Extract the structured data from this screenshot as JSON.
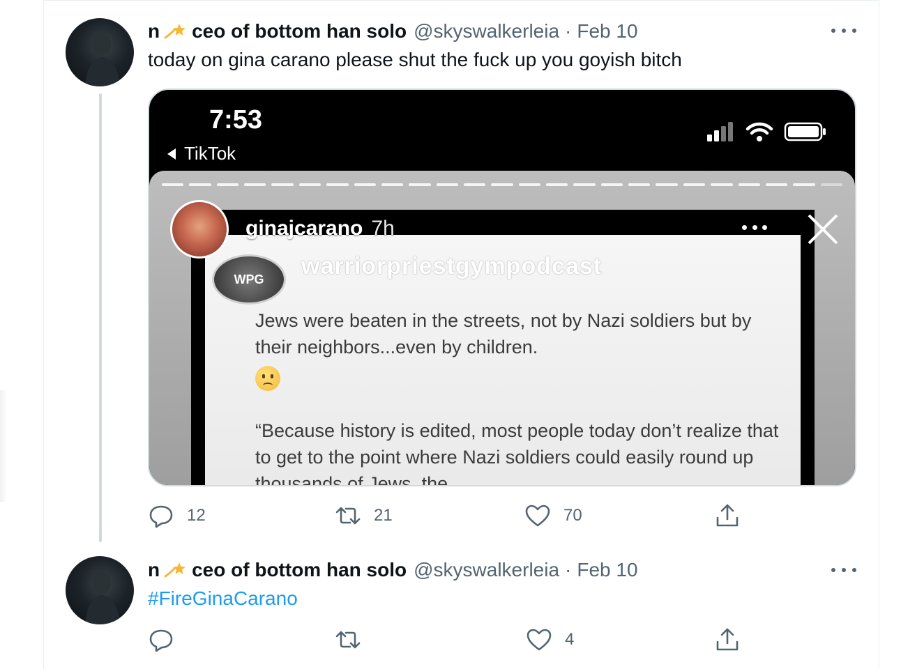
{
  "tweets": [
    {
      "display_name_short": "n",
      "display_name_rest": "ceo of bottom han solo",
      "handle": "@skyswalkerleia",
      "separator": "·",
      "date": "Feb 10",
      "text": "today on gina carano please shut the fuck up you goyish bitch",
      "media": {
        "phone_time": "7:53",
        "back_app": "TikTok",
        "story_username": "ginajcarano",
        "story_time": "7h",
        "logo_text": "WPG",
        "watermark": "warriorpriestgympodcast",
        "paragraph1": "Jews were beaten in the streets, not by Nazi soldiers but by their neighbors...even by children.",
        "paragraph2": "“Because history is edited, most people today don’t realize that to get to the point where Nazi soldiers could easily round up thousands of Jews, the"
      },
      "actions": {
        "replies": "12",
        "retweets": "21",
        "likes": "70"
      }
    },
    {
      "display_name_short": "n",
      "display_name_rest": "ceo of bottom han solo",
      "handle": "@skyswalkerleia",
      "separator": "·",
      "date": "Feb 10",
      "text": "#FireGinaCarano",
      "actions": {
        "replies": "",
        "retweets": "",
        "likes": "4"
      }
    }
  ],
  "colors": {
    "hashtag": "#1d9bf0",
    "secondary": "#536471",
    "border": "#cfd9de"
  }
}
